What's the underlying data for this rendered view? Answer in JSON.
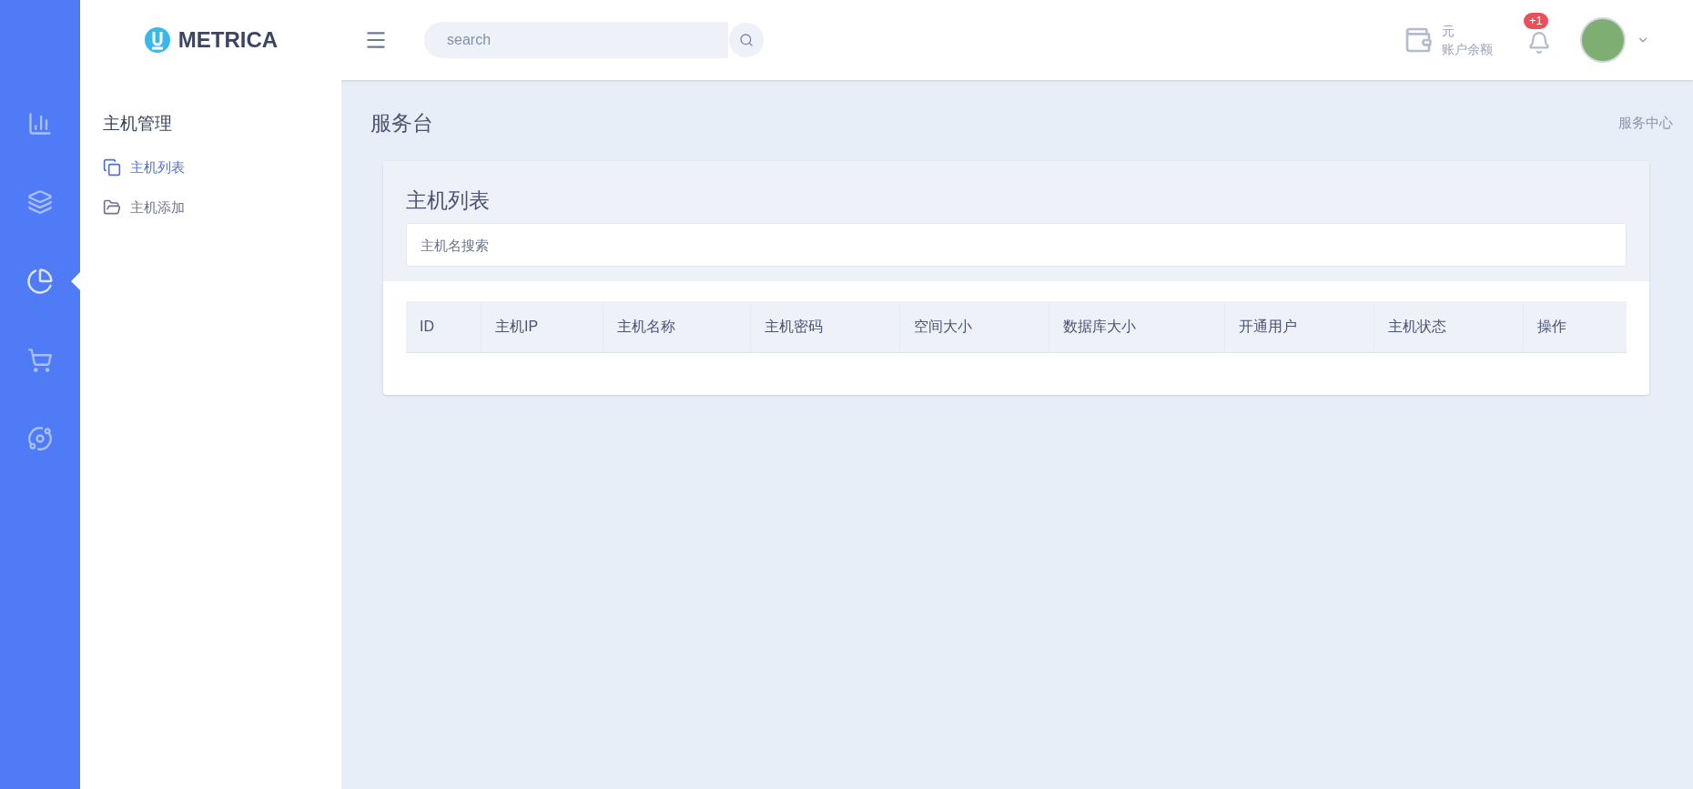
{
  "header": {
    "logo": "METRICA",
    "search": {
      "placeholder": "search"
    },
    "balance": {
      "amount": "元",
      "label": "账户余额"
    },
    "notifications": {
      "badge": "+1"
    }
  },
  "rail": [
    {
      "kind": "chart",
      "selected": false
    },
    {
      "kind": "layers",
      "selected": false
    },
    {
      "kind": "pie",
      "selected": true
    },
    {
      "kind": "cart",
      "selected": false
    },
    {
      "kind": "planet",
      "selected": false
    }
  ],
  "sidebar": {
    "title": "主机管理",
    "items": [
      {
        "label": "主机列表",
        "kind": "copy",
        "selected": true
      },
      {
        "label": "主机添加",
        "kind": "folder",
        "selected": false
      }
    ]
  },
  "page": {
    "title": "服务台",
    "breadcrumb": "服务中心"
  },
  "card": {
    "title": "主机列表",
    "search": {
      "placeholder": "主机名搜索"
    },
    "table": {
      "columns": [
        "ID",
        "主机IP",
        "主机名称",
        "主机密码",
        "空间大小",
        "数据库大小",
        "开通用户",
        "主机状态",
        "操作"
      ]
    }
  }
}
